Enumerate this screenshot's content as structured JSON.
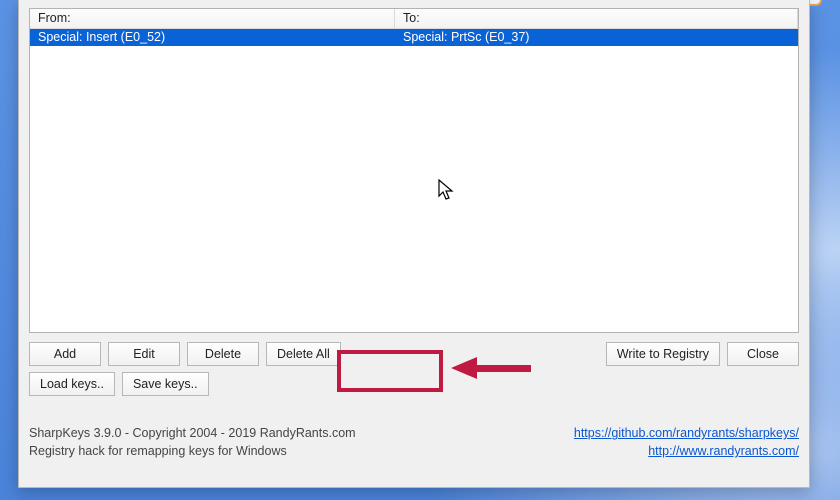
{
  "listview": {
    "col_from": "From:",
    "col_to": "To:",
    "rows": [
      {
        "from": "Special: Insert (E0_52)",
        "to": "Special: PrtSc (E0_37)"
      }
    ]
  },
  "buttons": {
    "add": "Add",
    "edit": "Edit",
    "delete": "Delete",
    "delete_all": "Delete All",
    "write_registry": "Write to Registry",
    "close": "Close",
    "load_keys": "Load keys..",
    "save_keys": "Save keys.."
  },
  "footer": {
    "line1": "SharpKeys 3.9.0 - Copyright 2004 - 2019 RandyRants.com",
    "line2": "Registry hack for remapping keys for Windows",
    "link1": "https://github.com/randyrants/sharpkeys/",
    "link2": "http://www.randyrants.com/"
  }
}
